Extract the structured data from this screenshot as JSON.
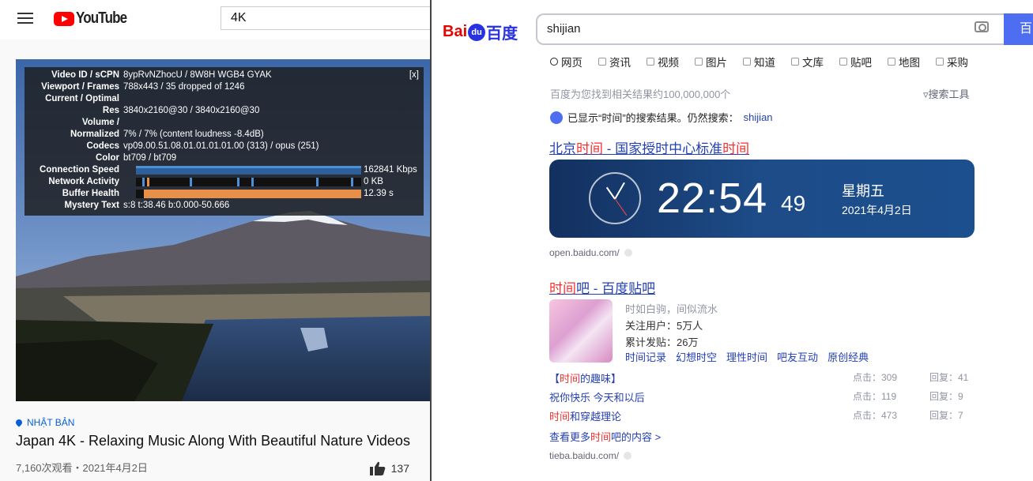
{
  "youtube": {
    "logo_text": "YouTube",
    "search_value": "4K",
    "stats": {
      "close": "[x]",
      "rows": [
        {
          "label": "Video ID / sCPN",
          "value": "8ypRvNZhocU / 8W8H WGB4 GYAK"
        },
        {
          "label": "Viewport / Frames",
          "value": "788x443 / 35 dropped of 1246"
        },
        {
          "label": "Current / Optimal",
          "value": ""
        },
        {
          "label": "Res",
          "value": "3840x2160@30 / 3840x2160@30"
        },
        {
          "label": "Volume /",
          "value": ""
        },
        {
          "label": "Normalized",
          "value": "7% / 7% (content loudness -8.4dB)"
        },
        {
          "label": "Codecs",
          "value": "vp09.00.51.08.01.01.01.01.00 (313) / opus (251)"
        },
        {
          "label": "Color",
          "value": "bt709 / bt709"
        },
        {
          "label": "Connection Speed",
          "value": "162841 Kbps"
        },
        {
          "label": "Network Activity",
          "value": "0 KB"
        },
        {
          "label": "Buffer Health",
          "value": "12.39 s"
        },
        {
          "label": "Mystery Text",
          "value": "s:8 t:38.46 b:0.000-50.666"
        }
      ]
    },
    "location": "NHẬT BẢN",
    "video_title": "Japan 4K - Relaxing Music Along With Beautiful Nature Videos",
    "views": "7,160次观看・2021年4月2日",
    "likes": "137",
    "colors": {
      "brand": "#ff0000",
      "link": "#065fd4"
    }
  },
  "baidu": {
    "logo": {
      "bai": "Bai",
      "paw": "du",
      "du": "百度"
    },
    "search_value": "shijian",
    "search_button": "百",
    "tabs": [
      "网页",
      "资讯",
      "视频",
      "图片",
      "知道",
      "文库",
      "贴吧",
      "地图",
      "采购"
    ],
    "result_count": "百度为您找到相关结果约100,000,000个",
    "search_tools": "搜索工具",
    "shown_prefix": "已显示“时间”的搜索结果。仍然搜索：",
    "shown_keyword": "shijian",
    "result1": {
      "title_a": "北京",
      "title_hl1": "时间",
      "title_b": " - 国家授时中心标准",
      "title_hl2": "时间",
      "time": "22:54",
      "seconds": "49",
      "weekday": "星期五",
      "date": "2021年4月2日",
      "url": "open.baidu.com/"
    },
    "result2": {
      "title_hl": "时间",
      "title_rest": "吧 - 百度贴吧",
      "slogan": "时如白驹，间似流水",
      "followers": "关注用户：5万人",
      "posts_total": "累计发贴：26万",
      "links": [
        "时间记录",
        "幻想时空",
        "理性时间",
        "吧友互动",
        "原创经典"
      ],
      "posts": [
        {
          "pre": "【",
          "hl": "时间",
          "post": "的趣味】",
          "clicks": "点击：309",
          "replies": "回复：41"
        },
        {
          "pre": "祝你快乐 今天和以后",
          "hl": "",
          "post": "",
          "clicks": "点击：119",
          "replies": "回复：9"
        },
        {
          "pre": "",
          "hl": "时间",
          "post": "和穿越理论",
          "clicks": "点击：473",
          "replies": "回复：7"
        }
      ],
      "more_pre": "查看更多",
      "more_hl": "时间",
      "more_post": "吧的内容 >",
      "url": "tieba.baidu.com/"
    },
    "colors": {
      "link": "#2440b3",
      "highlight": "#f73131",
      "button": "#4e6ef2"
    }
  }
}
